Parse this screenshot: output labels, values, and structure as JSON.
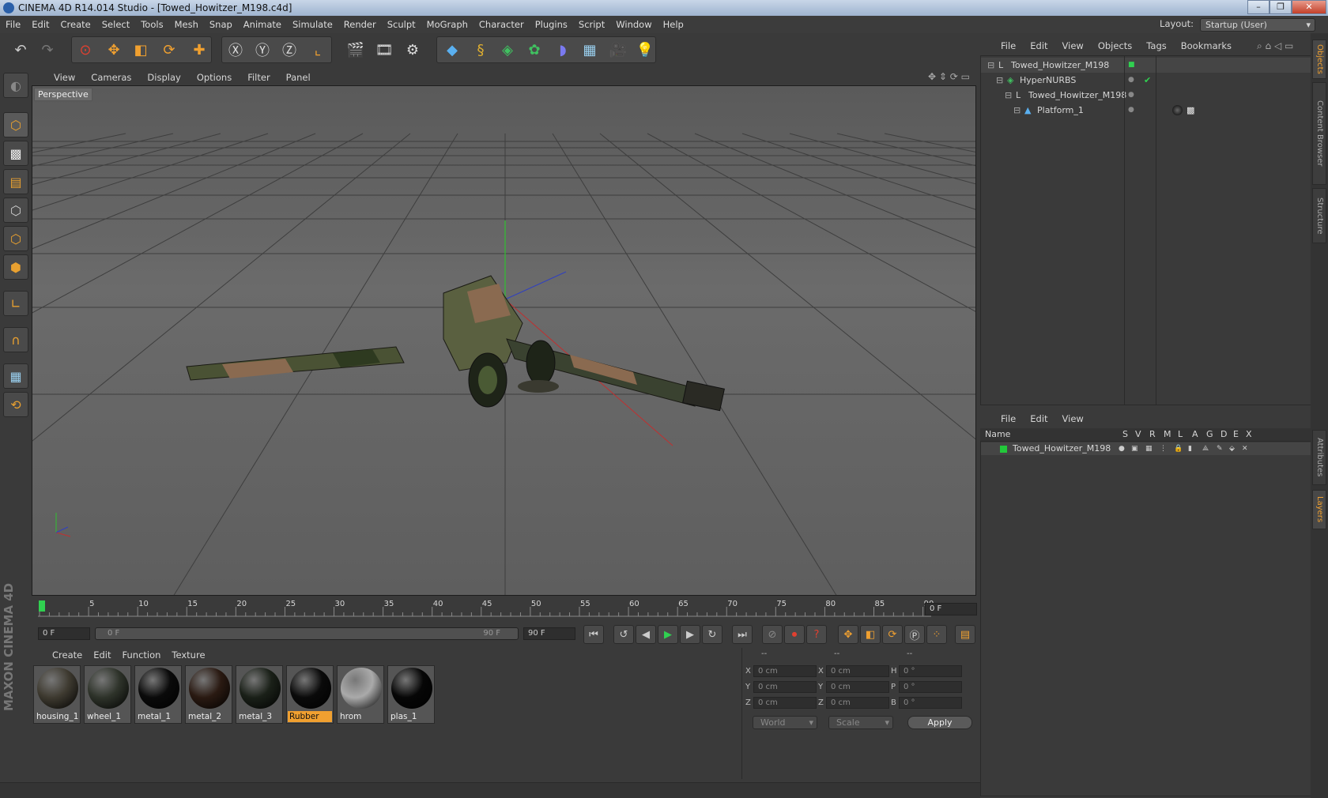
{
  "window": {
    "title": "CINEMA 4D R14.014 Studio - [Towed_Howitzer_M198.c4d]"
  },
  "menubar": [
    "File",
    "Edit",
    "Create",
    "Select",
    "Tools",
    "Mesh",
    "Snap",
    "Animate",
    "Simulate",
    "Render",
    "Sculpt",
    "MoGraph",
    "Character",
    "Plugins",
    "Script",
    "Window",
    "Help"
  ],
  "layout": {
    "label": "Layout:",
    "value": "Startup (User)"
  },
  "viewport": {
    "menu": [
      "View",
      "Cameras",
      "Display",
      "Options",
      "Filter",
      "Panel"
    ],
    "label": "Perspective"
  },
  "timeline": {
    "ticks": [
      "0",
      "5",
      "10",
      "15",
      "20",
      "25",
      "30",
      "35",
      "40",
      "45",
      "50",
      "55",
      "60",
      "65",
      "70",
      "75",
      "80",
      "85",
      "90"
    ],
    "current_frame": "0 F",
    "start_field": "0 F",
    "range_start": "0 F",
    "range_end": "90 F",
    "end_field": "90 F"
  },
  "materials": {
    "menu": [
      "Create",
      "Edit",
      "Function",
      "Texture"
    ],
    "items": [
      {
        "name": "housing_1",
        "color": "#3e3a30"
      },
      {
        "name": "wheel_1",
        "color": "#2e332a"
      },
      {
        "name": "metal_1",
        "color": "#0a0a0a"
      },
      {
        "name": "metal_2",
        "color": "#2a1a12"
      },
      {
        "name": "metal_3",
        "color": "#1a2018"
      },
      {
        "name": "Rubber",
        "color": "#0a0a0a",
        "selected": true
      },
      {
        "name": "hrom",
        "color": "#aaaaaa"
      },
      {
        "name": "plas_1",
        "color": "#060606"
      }
    ]
  },
  "coordinates": {
    "headers": [
      "--",
      "--",
      "--"
    ],
    "rows": [
      {
        "a": "X",
        "v1": "0 cm",
        "b": "X",
        "v2": "0 cm",
        "c": "H",
        "v3": "0 °"
      },
      {
        "a": "Y",
        "v1": "0 cm",
        "b": "Y",
        "v2": "0 cm",
        "c": "P",
        "v3": "0 °"
      },
      {
        "a": "Z",
        "v1": "0 cm",
        "b": "Z",
        "v2": "0 cm",
        "c": "B",
        "v3": "0 °"
      }
    ],
    "mode1": "World",
    "mode2": "Scale",
    "apply": "Apply"
  },
  "object_manager": {
    "menu": [
      "File",
      "Edit",
      "View",
      "Objects",
      "Tags",
      "Bookmarks"
    ],
    "objects": [
      {
        "name": "Towed_Howitzer_M198",
        "depth": 0,
        "icon": "null"
      },
      {
        "name": "HyperNURBS",
        "depth": 1,
        "icon": "nurbs"
      },
      {
        "name": "Towed_Howitzer_M198",
        "depth": 2,
        "icon": "null"
      },
      {
        "name": "Platform_1",
        "depth": 3,
        "icon": "poly"
      }
    ]
  },
  "layer_manager": {
    "menu": [
      "File",
      "Edit",
      "View"
    ],
    "columns": [
      "Name",
      "S",
      "V",
      "R",
      "M",
      "L",
      "A",
      "G",
      "D",
      "E",
      "X"
    ],
    "layers": [
      {
        "name": "Towed_Howitzer_M198",
        "color": "#22c83a"
      }
    ]
  },
  "side_tabs": [
    "Objects",
    "Content Browser",
    "Structure",
    "Attributes",
    "Layers"
  ],
  "brand": "MAXON CINEMA 4D",
  "colors": {
    "accent": "#f0a030",
    "layer_green": "#22c83a"
  }
}
